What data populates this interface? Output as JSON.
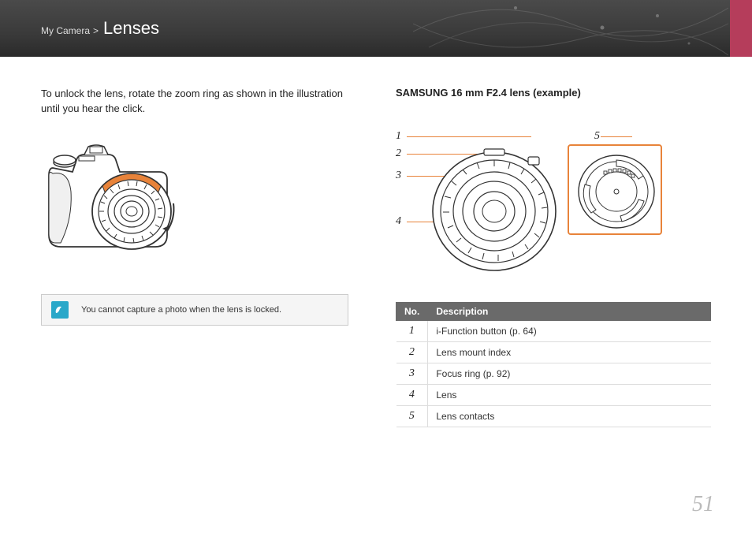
{
  "breadcrumb": {
    "parent": "My Camera",
    "separator": ">",
    "current": "Lenses"
  },
  "left": {
    "intro": "To unlock the lens, rotate the zoom ring as shown in the illustration until you hear the click.",
    "note": "You cannot capture a photo when the lens is locked."
  },
  "right": {
    "example_title": "SAMSUNG 16 mm F2.4 lens (example)",
    "callouts": {
      "c1": "1",
      "c2": "2",
      "c3": "3",
      "c4": "4",
      "c5": "5"
    },
    "table": {
      "headers": {
        "no": "No.",
        "desc": "Description"
      },
      "rows": [
        {
          "no": "1",
          "desc": "i-Function button (p. 64)"
        },
        {
          "no": "2",
          "desc": "Lens mount index"
        },
        {
          "no": "3",
          "desc": "Focus ring (p. 92)"
        },
        {
          "no": "4",
          "desc": "Lens"
        },
        {
          "no": "5",
          "desc": "Lens contacts"
        }
      ]
    }
  },
  "page_number": "51"
}
